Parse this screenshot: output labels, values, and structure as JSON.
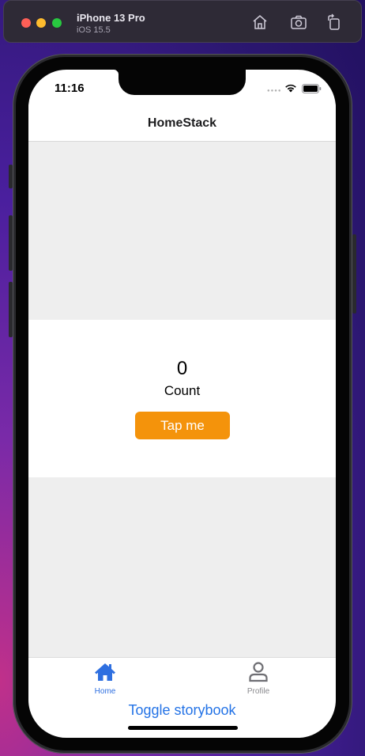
{
  "simulator": {
    "device_name": "iPhone 13 Pro",
    "os_version": "iOS 15.5",
    "toolbar_icons": [
      "home-icon",
      "screenshot-camera-icon",
      "rotate-icon"
    ]
  },
  "status_bar": {
    "time": "11:16",
    "icons": [
      "signal-dots-icon",
      "wifi-icon",
      "battery-icon"
    ]
  },
  "header": {
    "title": "HomeStack"
  },
  "counter": {
    "value": "0",
    "label": "Count",
    "button_label": "Tap me"
  },
  "tab_bar": {
    "tabs": [
      {
        "label": "Home",
        "icon": "house-icon",
        "active": true
      },
      {
        "label": "Profile",
        "icon": "person-icon",
        "active": false
      }
    ]
  },
  "footer": {
    "toggle_label": "Toggle storybook"
  },
  "colors": {
    "accent_button": "#f4930b",
    "active_tab": "#2e6fe0",
    "inactive_tab": "#8a8a8e",
    "link": "#2473e6",
    "content_bg": "#eeeeee"
  }
}
